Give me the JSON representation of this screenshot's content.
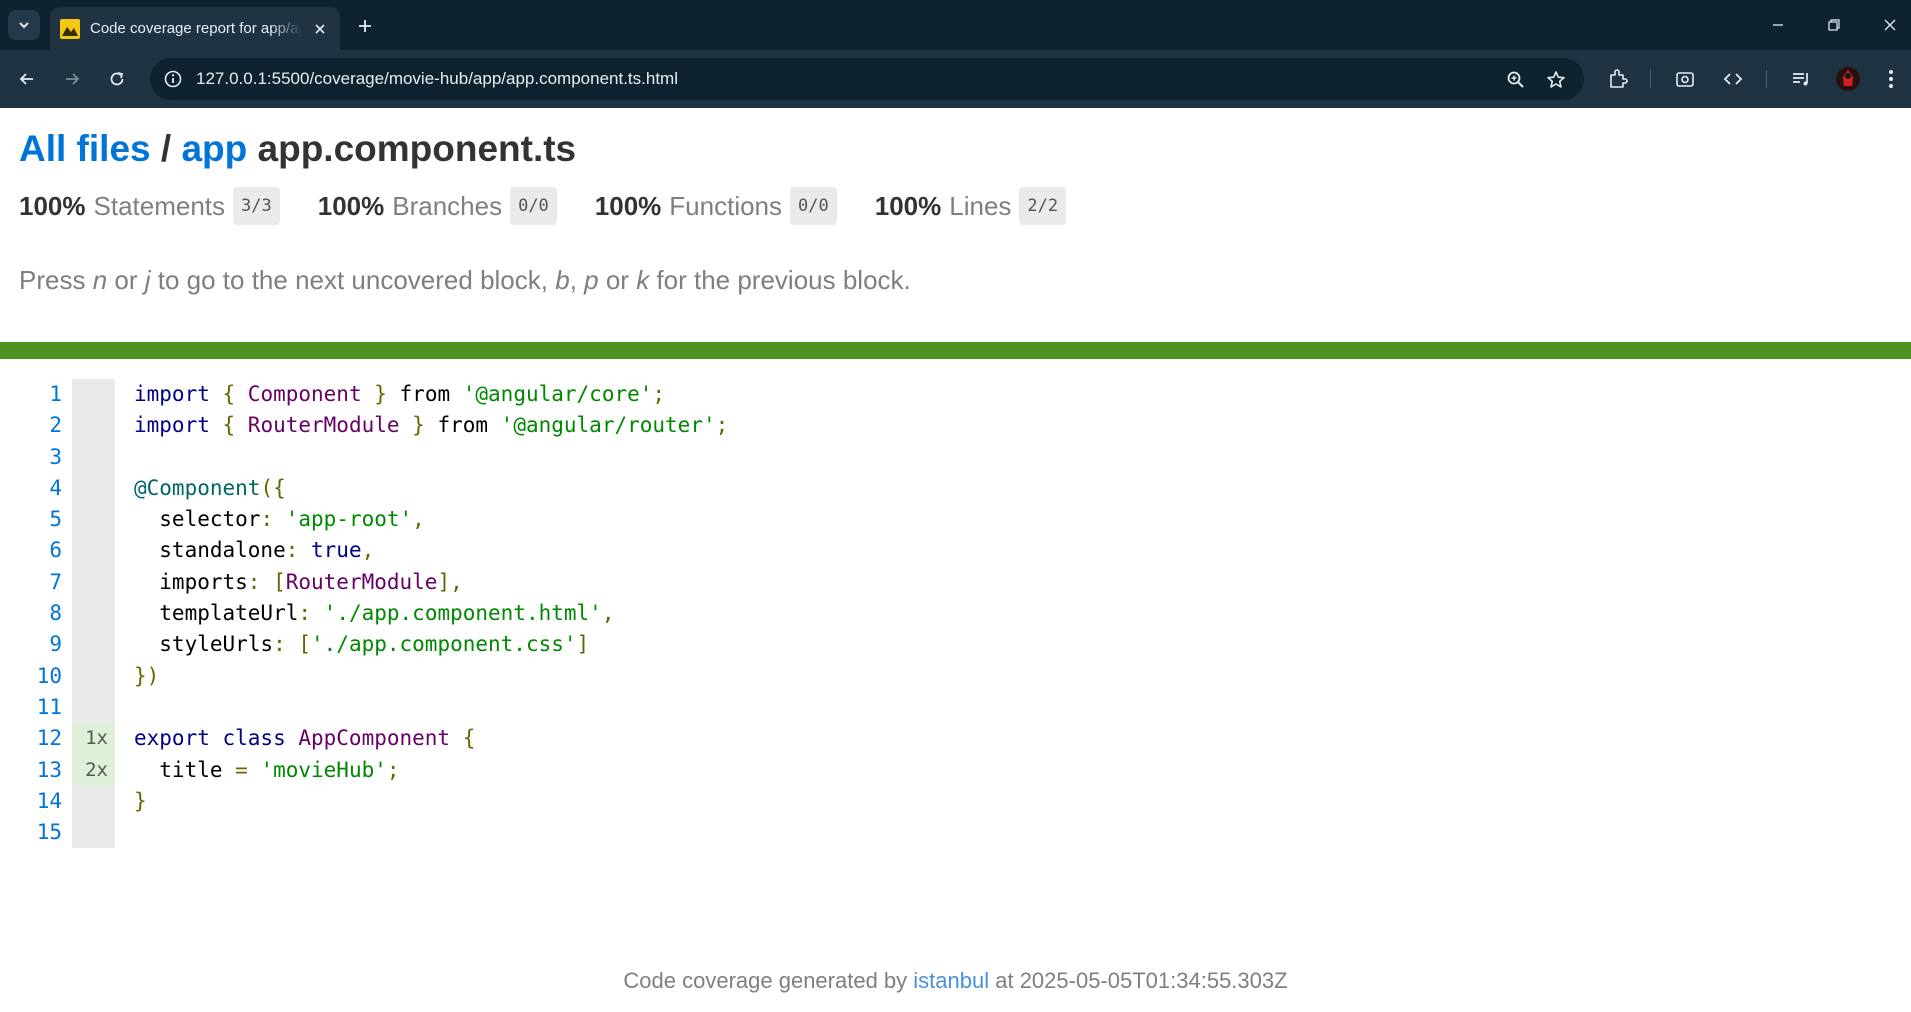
{
  "browser": {
    "tab_title": "Code coverage report for app/app.component.ts",
    "url": "127.0.0.1:5500/coverage/movie-hub/app/app.component.ts.html"
  },
  "header": {
    "crumb_all_files": "All files",
    "crumb_sep": " / ",
    "crumb_app": "app",
    "file_name": "app.component.ts"
  },
  "stats": [
    {
      "pct": "100%",
      "label": "Statements",
      "frac": "3/3"
    },
    {
      "pct": "100%",
      "label": "Branches",
      "frac": "0/0"
    },
    {
      "pct": "100%",
      "label": "Functions",
      "frac": "0/0"
    },
    {
      "pct": "100%",
      "label": "Lines",
      "frac": "2/2"
    }
  ],
  "hint": {
    "t1": "Press ",
    "k1": "n",
    "t2": " or ",
    "k2": "j",
    "t3": " to go to the next uncovered block, ",
    "k3": "b",
    "t4": ", ",
    "k4": "p",
    "t5": " or ",
    "k5": "k",
    "t6": " for the previous block."
  },
  "status_color": "#4d9221",
  "code_lines": [
    {
      "n": "1",
      "hits": "",
      "tokens": [
        [
          "kw",
          "import"
        ],
        [
          "pn",
          " { "
        ],
        [
          "ty",
          "Component"
        ],
        [
          "pn",
          " } "
        ],
        [
          "",
          ""
        ],
        [
          "",
          "from"
        ],
        [
          "",
          ""
        ],
        [
          "st",
          " '@angular/core'"
        ],
        [
          "pn",
          ";"
        ]
      ]
    },
    {
      "n": "2",
      "hits": "",
      "tokens": [
        [
          "kw",
          "import"
        ],
        [
          "pn",
          " { "
        ],
        [
          "ty",
          "RouterModule"
        ],
        [
          "pn",
          " } "
        ],
        [
          "",
          "from"
        ],
        [
          "st",
          " '@angular/router'"
        ],
        [
          "pn",
          ";"
        ]
      ]
    },
    {
      "n": "3",
      "hits": "",
      "tokens": []
    },
    {
      "n": "4",
      "hits": "",
      "tokens": [
        [
          "at",
          "@Component"
        ],
        [
          "pn",
          "({"
        ]
      ]
    },
    {
      "n": "5",
      "hits": "",
      "tokens": [
        [
          "",
          "  selector"
        ],
        [
          "pn",
          ": "
        ],
        [
          "st",
          "'app-root'"
        ],
        [
          "pn",
          ","
        ]
      ]
    },
    {
      "n": "6",
      "hits": "",
      "tokens": [
        [
          "",
          "  standalone"
        ],
        [
          "pn",
          ": "
        ],
        [
          "kw",
          "true"
        ],
        [
          "pn",
          ","
        ]
      ]
    },
    {
      "n": "7",
      "hits": "",
      "tokens": [
        [
          "",
          "  imports"
        ],
        [
          "pn",
          ": ["
        ],
        [
          "ty",
          "RouterModule"
        ],
        [
          "pn",
          "],"
        ]
      ]
    },
    {
      "n": "8",
      "hits": "",
      "tokens": [
        [
          "",
          "  templateUrl"
        ],
        [
          "pn",
          ": "
        ],
        [
          "st",
          "'./app.component.html'"
        ],
        [
          "pn",
          ","
        ]
      ]
    },
    {
      "n": "9",
      "hits": "",
      "tokens": [
        [
          "",
          "  styleUrls"
        ],
        [
          "pn",
          ": ["
        ],
        [
          "st",
          "'./app.component.css'"
        ],
        [
          "pn",
          "]"
        ]
      ]
    },
    {
      "n": "10",
      "hits": "",
      "tokens": [
        [
          "pn",
          "})"
        ]
      ]
    },
    {
      "n": "11",
      "hits": "",
      "tokens": []
    },
    {
      "n": "12",
      "hits": "1x",
      "tokens": [
        [
          "kw",
          "export"
        ],
        [
          "",
          ""
        ],
        [
          "kw",
          " class"
        ],
        [
          "ty",
          " AppComponent"
        ],
        [
          "pn",
          " {"
        ]
      ]
    },
    {
      "n": "13",
      "hits": "2x",
      "tokens": [
        [
          "",
          "  title"
        ],
        [
          "pn",
          " = "
        ],
        [
          "st",
          "'movieHub'"
        ],
        [
          "pn",
          ";"
        ]
      ]
    },
    {
      "n": "14",
      "hits": "",
      "tokens": [
        [
          "pn",
          "}"
        ]
      ]
    },
    {
      "n": "15",
      "hits": "",
      "tokens": []
    }
  ],
  "footer": {
    "prefix": "Code coverage generated by ",
    "tool": "istanbul",
    "suffix": " at 2025-05-05T01:34:55.303Z"
  }
}
